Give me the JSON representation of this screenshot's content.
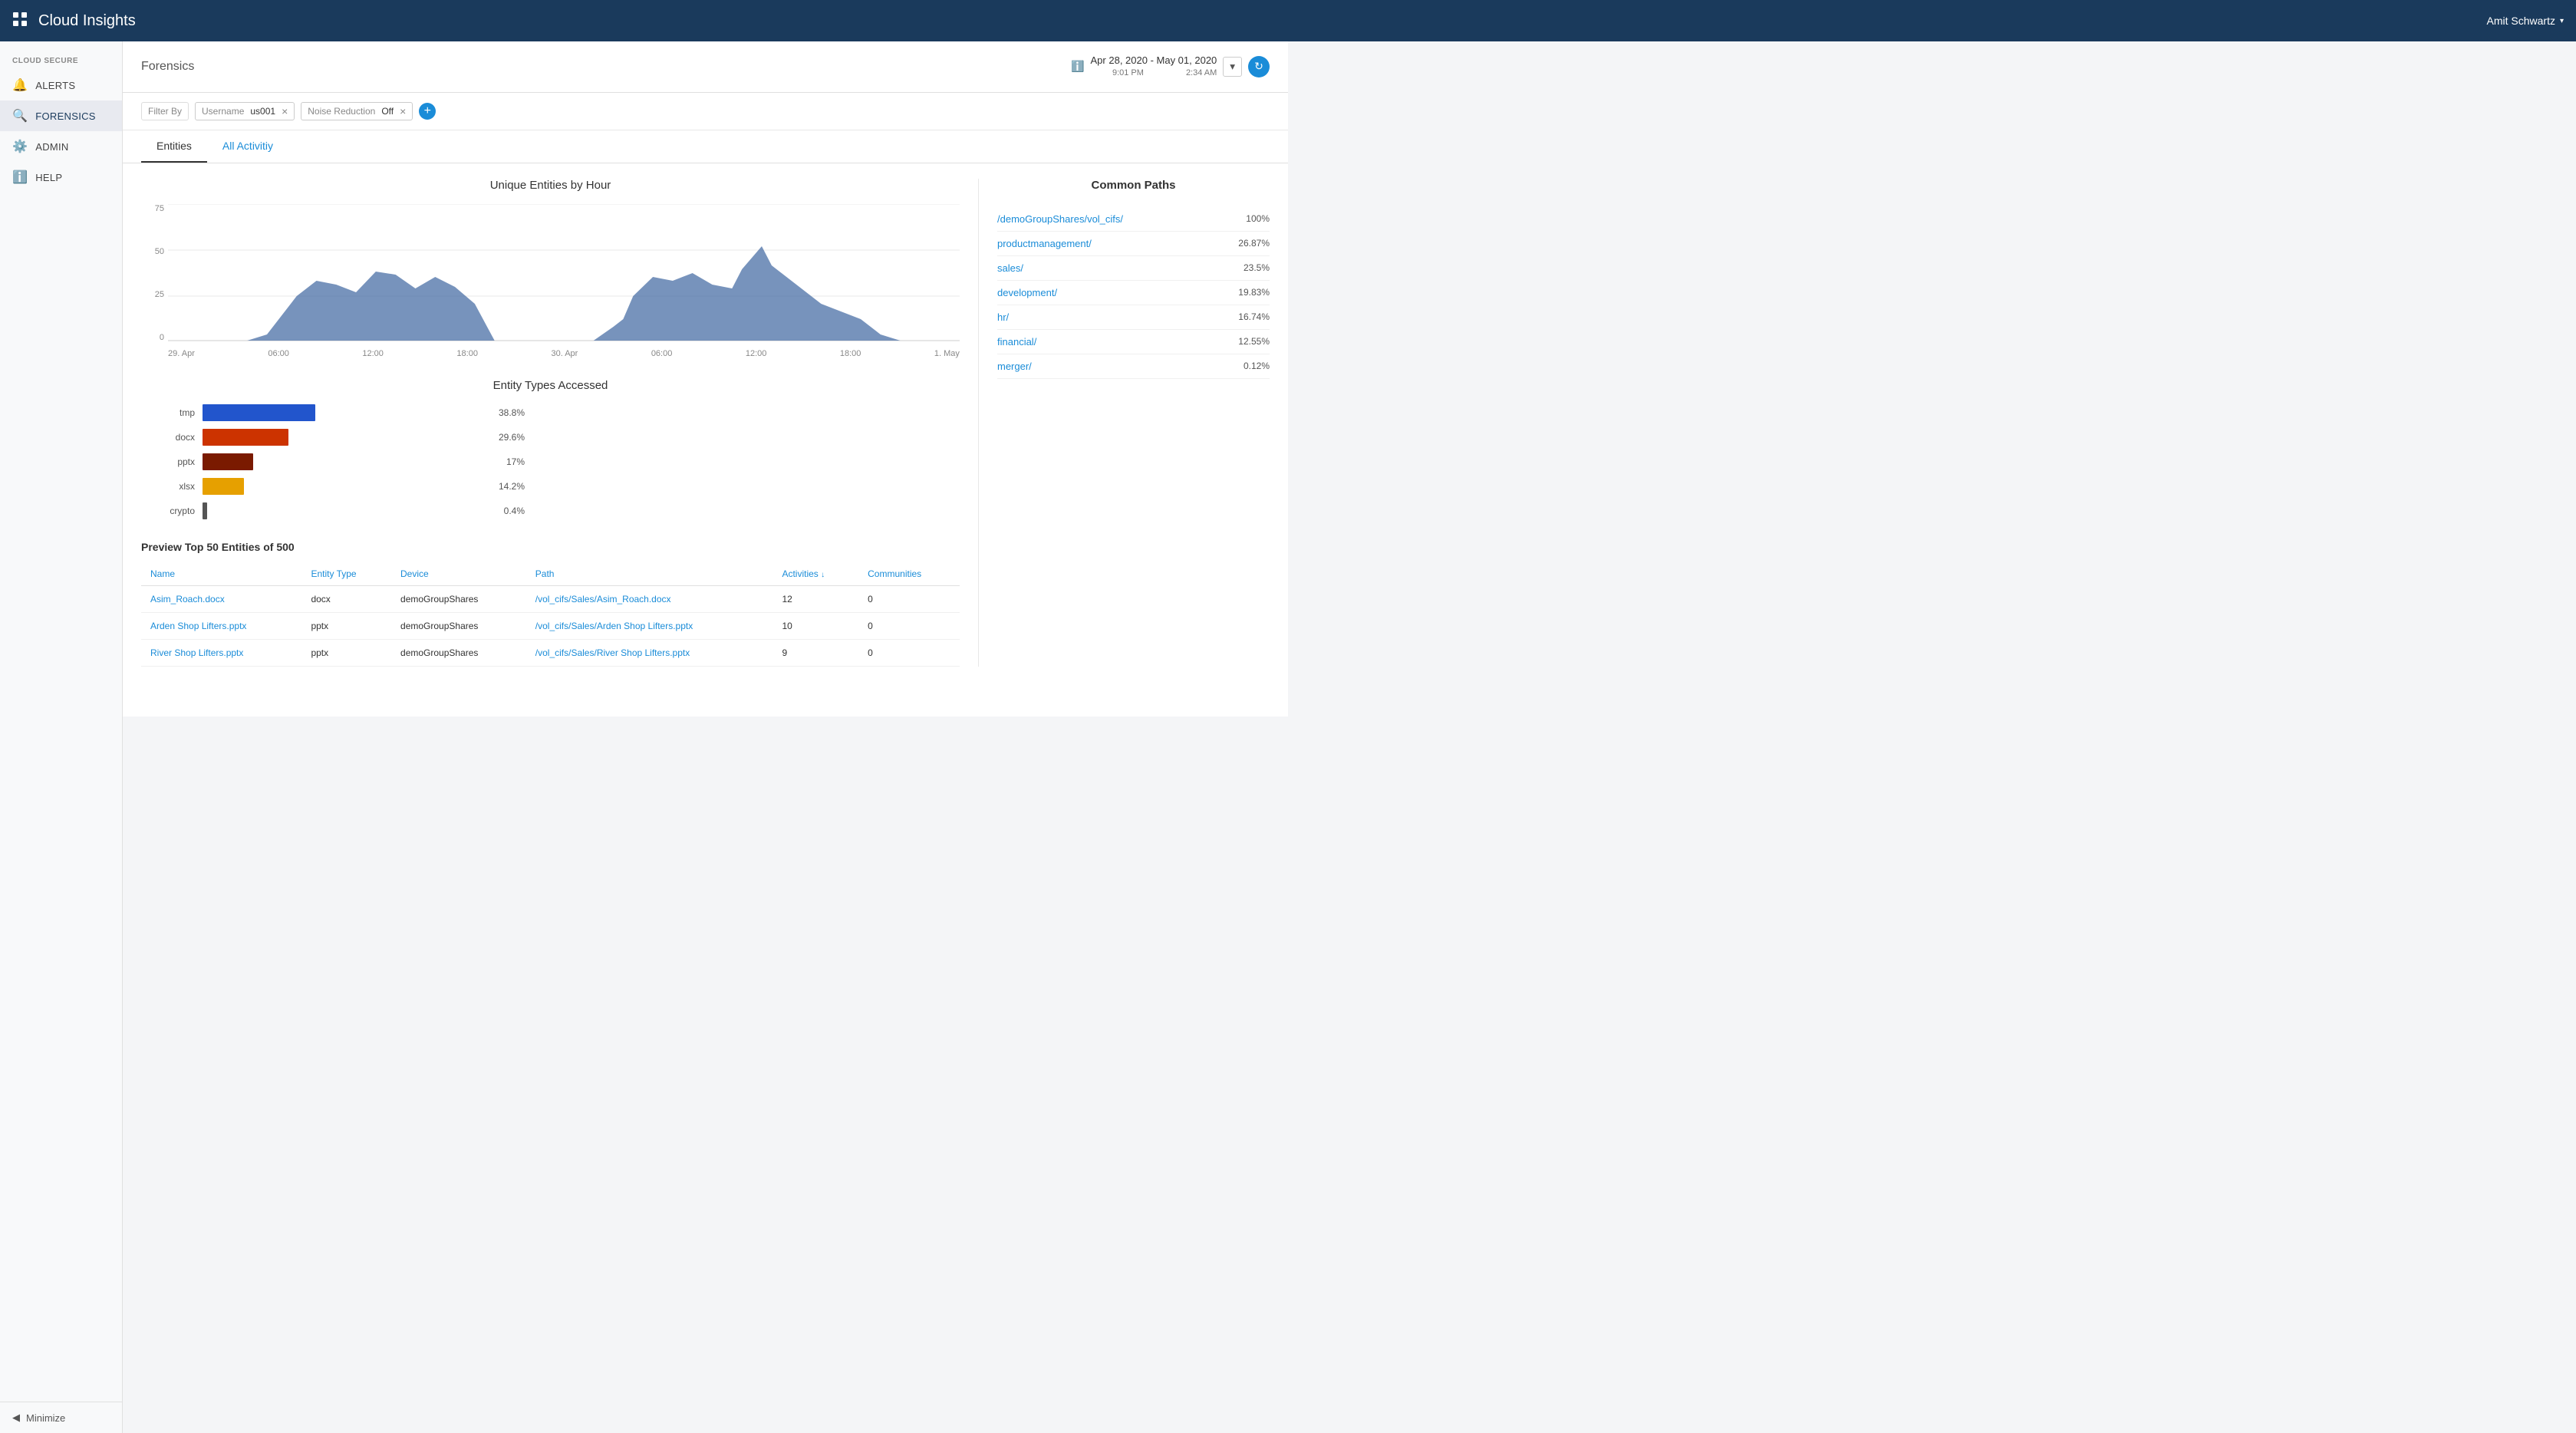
{
  "app": {
    "title": "Cloud Insights",
    "user": "Amit Schwartz"
  },
  "sidebar": {
    "section_label": "Cloud Secure",
    "items": [
      {
        "id": "alerts",
        "label": "Alerts",
        "icon": "🔔"
      },
      {
        "id": "forensics",
        "label": "Forensics",
        "icon": "🔍",
        "active": true
      },
      {
        "id": "admin",
        "label": "Admin",
        "icon": "⚙️"
      },
      {
        "id": "help",
        "label": "Help",
        "icon": "ℹ️"
      }
    ],
    "minimize_label": "Minimize"
  },
  "header": {
    "page_title": "Forensics",
    "date_range": {
      "label": "Apr 28, 2020 - May 01, 2020",
      "start_time": "9:01 PM",
      "end_time": "2:34 AM"
    }
  },
  "filters": {
    "label": "Filter By",
    "tags": [
      {
        "key": "Username",
        "value": "us001"
      },
      {
        "key": "Noise Reduction",
        "value": "Off"
      }
    ]
  },
  "tabs": [
    {
      "id": "entities",
      "label": "Entities",
      "active": true
    },
    {
      "id": "all-activity",
      "label": "All Activitiy",
      "active": false
    }
  ],
  "chart": {
    "title": "Unique Entities by Hour",
    "y_labels": [
      "75",
      "50",
      "25",
      "0"
    ],
    "x_labels": [
      "29. Apr",
      "06:00",
      "12:00",
      "18:00",
      "30. Apr",
      "06:00",
      "12:00",
      "18:00",
      "1. May"
    ]
  },
  "bar_chart": {
    "title": "Entity Types Accessed",
    "bars": [
      {
        "label": "tmp",
        "value": "38.8%",
        "pct": 38.8,
        "color": "#2255cc"
      },
      {
        "label": "docx",
        "value": "29.6%",
        "pct": 29.6,
        "color": "#cc3300"
      },
      {
        "label": "pptx",
        "value": "17%",
        "pct": 17,
        "color": "#7a1a00"
      },
      {
        "label": "xlsx",
        "value": "14.2%",
        "pct": 14.2,
        "color": "#e6a000"
      },
      {
        "label": "crypto",
        "value": "0.4%",
        "pct": 0.4,
        "color": "#555"
      }
    ]
  },
  "common_paths": {
    "title": "Common Paths",
    "paths": [
      {
        "name": "/demoGroupShares/vol_cifs/",
        "pct": "100%"
      },
      {
        "name": "productmanagement/",
        "pct": "26.87%"
      },
      {
        "name": "sales/",
        "pct": "23.5%"
      },
      {
        "name": "development/",
        "pct": "19.83%"
      },
      {
        "name": "hr/",
        "pct": "16.74%"
      },
      {
        "name": "financial/",
        "pct": "12.55%"
      },
      {
        "name": "merger/",
        "pct": "0.12%"
      }
    ]
  },
  "table": {
    "title": "Preview Top 50 Entities of 500",
    "columns": [
      "Name",
      "Entity Type",
      "Device",
      "Path",
      "Activities",
      "Communities"
    ],
    "rows": [
      {
        "name": "Asim_Roach.docx",
        "entity_type": "docx",
        "device": "demoGroupShares",
        "path": "/vol_cifs/Sales/Asim_Roach.docx",
        "activities": "12",
        "communities": "0"
      },
      {
        "name": "Arden Shop Lifters.pptx",
        "entity_type": "pptx",
        "device": "demoGroupShares",
        "path": "/vol_cifs/Sales/Arden Shop Lifters.pptx",
        "activities": "10",
        "communities": "0"
      },
      {
        "name": "River Shop Lifters.pptx",
        "entity_type": "pptx",
        "device": "demoGroupShares",
        "path": "/vol_cifs/Sales/River Shop Lifters.pptx",
        "activities": "9",
        "communities": "0"
      }
    ]
  }
}
